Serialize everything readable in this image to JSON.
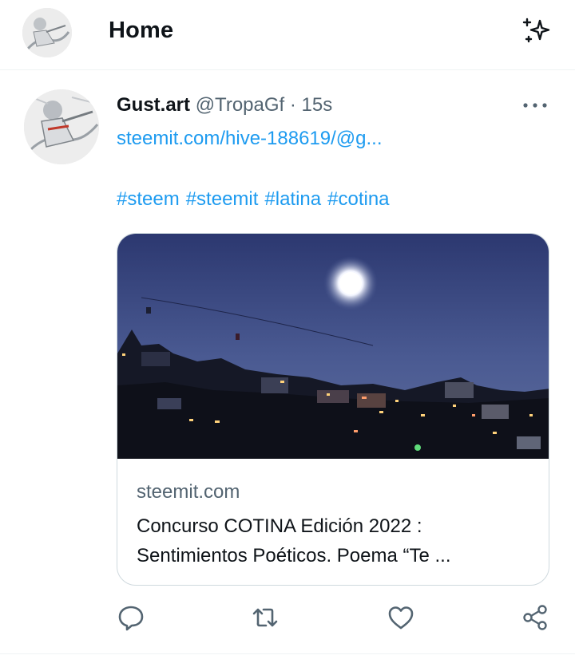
{
  "header": {
    "title": "Home"
  },
  "tweet": {
    "author_name": "Gust.art",
    "handle": "@TropaGf",
    "separator": "·",
    "time": "15s",
    "link_text": "steemit.com/hive-188619/@g...",
    "hashtags": [
      "#steem",
      "#steemit",
      "#latina",
      "#cotina"
    ],
    "card": {
      "domain": "steemit.com",
      "title_line1": "Concurso COTINA Edición 2022 :",
      "title_line2": "Sentimientos Poéticos. Poema “Te ..."
    }
  },
  "colors": {
    "accent": "#1d9bf0",
    "muted": "#536471",
    "text": "#0f1419",
    "border": "#cfd9de"
  },
  "icons": [
    "sparkle-icon",
    "more-icon",
    "reply-icon",
    "retweet-icon",
    "like-icon",
    "share-icon"
  ]
}
